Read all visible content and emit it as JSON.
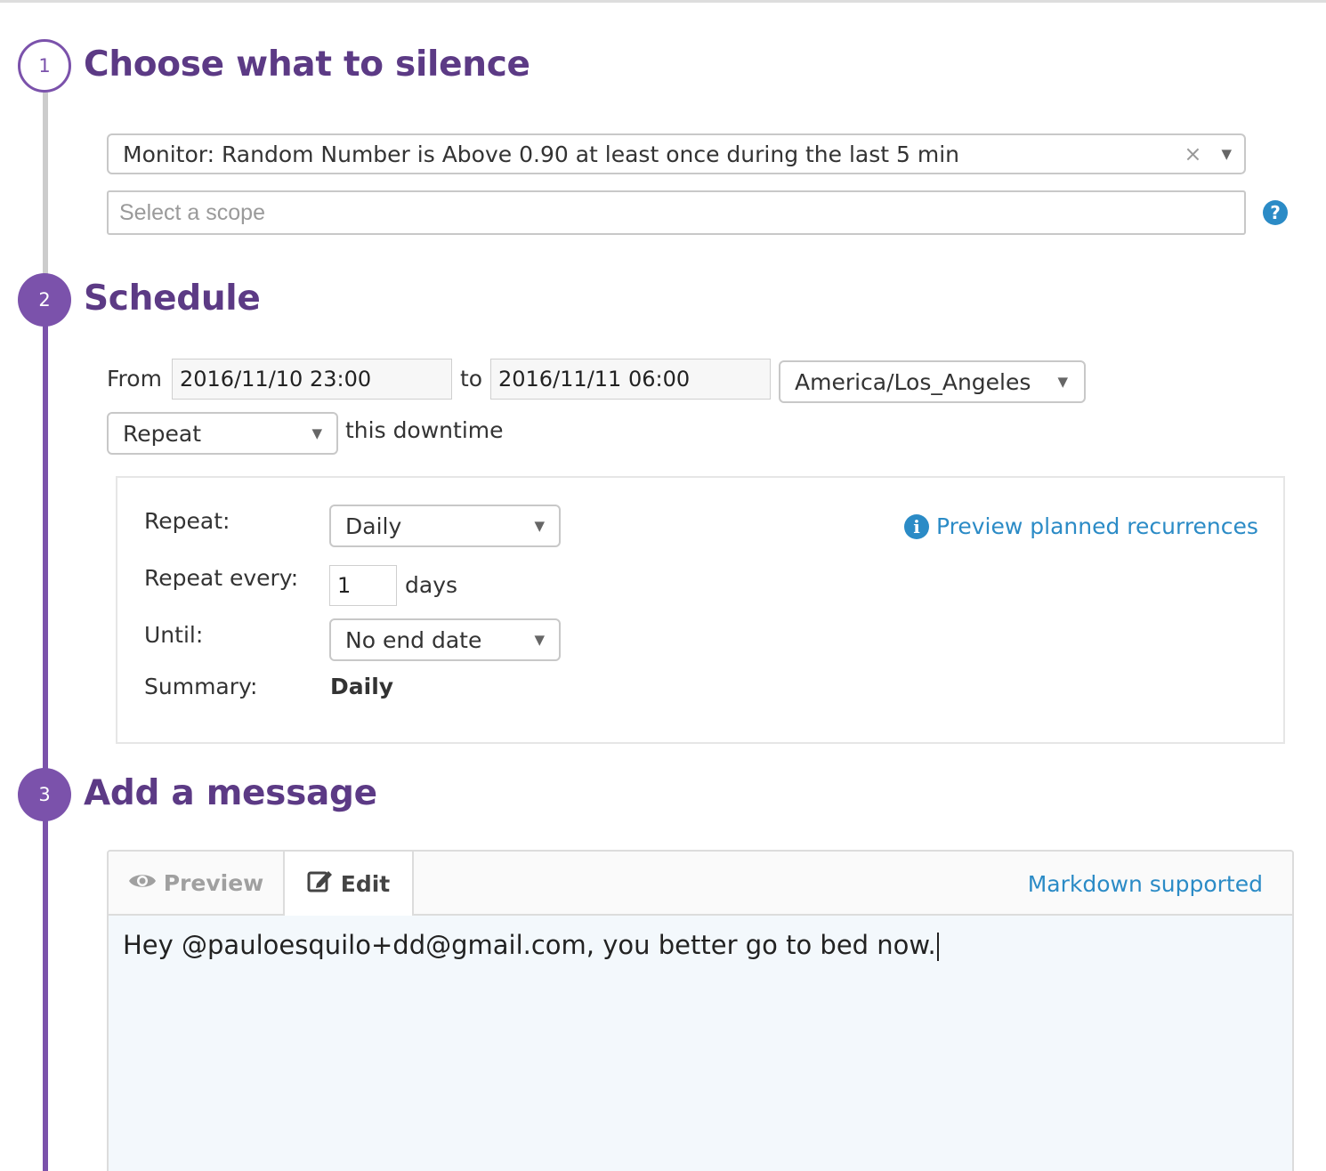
{
  "steps": [
    {
      "number": "1",
      "title": "Choose what to silence"
    },
    {
      "number": "2",
      "title": "Schedule"
    },
    {
      "number": "3",
      "title": "Add a message"
    }
  ],
  "silence": {
    "monitor_value": "Monitor: Random Number is Above 0.90 at least once during the last 5 min",
    "clear_glyph": "×",
    "scope_placeholder": "Select a scope",
    "help_glyph": "?"
  },
  "schedule": {
    "from_label": "From",
    "from_value": "2016/11/10 23:00",
    "to_label": "to",
    "to_value": "2016/11/11 06:00",
    "timezone": "America/Los_Angeles",
    "repeat_mode": "Repeat",
    "repeat_suffix": "this downtime",
    "recurrence": {
      "repeat_label": "Repeat:",
      "repeat_value": "Daily",
      "every_label": "Repeat every:",
      "every_value": "1",
      "every_unit": "days",
      "until_label": "Until:",
      "until_value": "No end date",
      "summary_label": "Summary:",
      "summary_value": "Daily",
      "preview_link": "Preview planned recurrences"
    }
  },
  "message": {
    "tab_preview": "Preview",
    "tab_edit": "Edit",
    "markdown_label": "Markdown supported",
    "text": "Hey @pauloesquilo+dd@gmail.com, you better go to bed now."
  },
  "caret_glyph": "▼",
  "colors": {
    "brand_purple": "#7b52ab",
    "title_purple": "#5c3a85",
    "link_blue": "#2b8bc6",
    "inactive_line": "#cccccc"
  }
}
